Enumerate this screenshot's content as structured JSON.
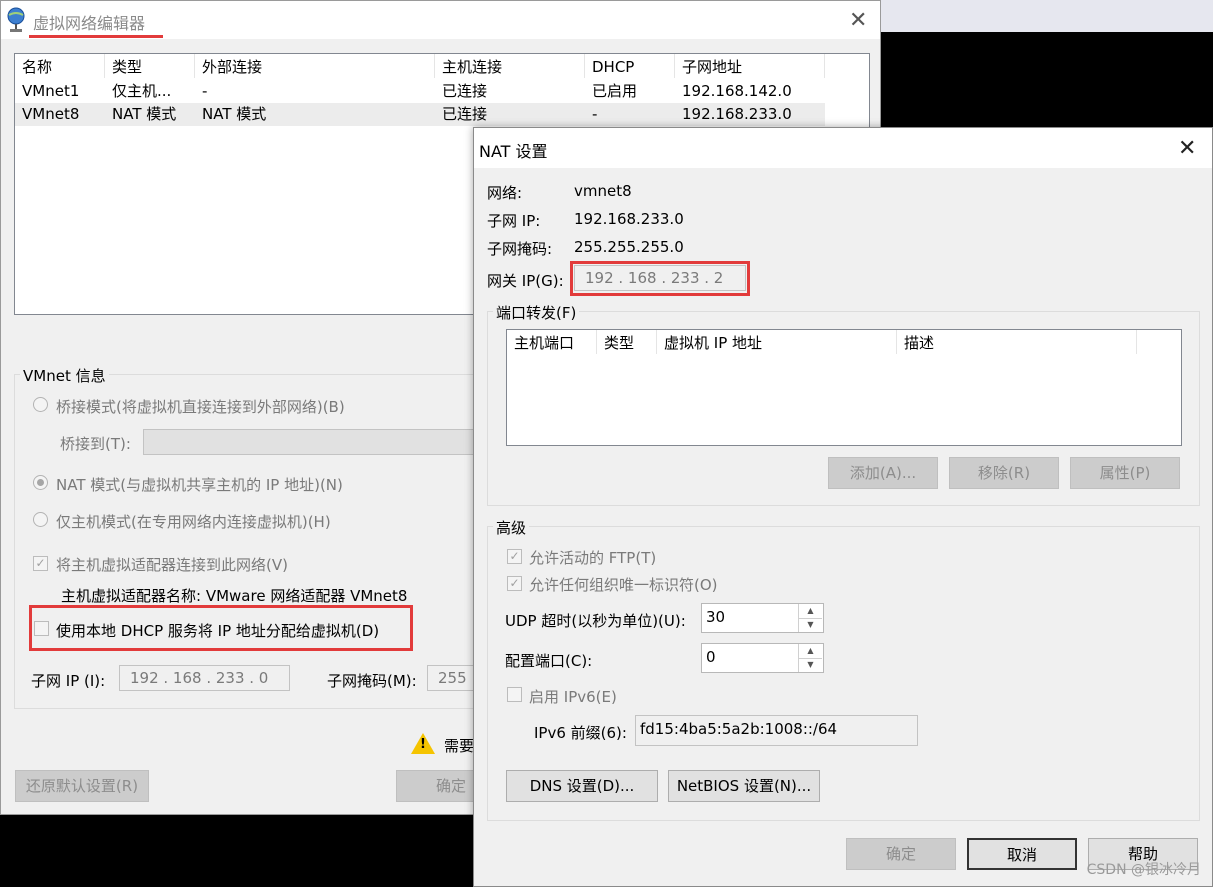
{
  "main_window": {
    "title": "虚拟网络编辑器",
    "close_glyph": "✕",
    "columns": [
      "名称",
      "类型",
      "外部连接",
      "主机连接",
      "DHCP",
      "子网地址"
    ],
    "rows": [
      [
        "VMnet1",
        "仅主机...",
        "-",
        "已连接",
        "已启用",
        "192.168.142.0"
      ],
      [
        "VMnet8",
        "NAT 模式",
        "NAT 模式",
        "已连接",
        "-",
        "192.168.233.0"
      ]
    ],
    "vmnet_info": {
      "title": "VMnet 信息",
      "bridged_label": "桥接模式(将虚拟机直接连接到外部网络)(B)",
      "bridge_to_label": "桥接到(T):",
      "nat_label": "NAT 模式(与虚拟机共享主机的 IP 地址)(N)",
      "hostonly_label": "仅主机模式(在专用网络内连接虚拟机)(H)",
      "connect_adapter_label": "将主机虚拟适配器连接到此网络(V)",
      "adapter_name_label": "主机虚拟适配器名称: VMware 网络适配器 VMnet8",
      "dhcp_label": "使用本地 DHCP 服务将 IP 地址分配给虚拟机(D)",
      "subnet_ip_label": "子网 IP (I):",
      "subnet_ip_value": "192 . 168 . 233 .  0",
      "subnet_mask_label": "子网掩码(M):",
      "subnet_mask_value": "255"
    },
    "warning_text": "需要",
    "restore_button": "还原默认设置(R)",
    "ok_button": "确定"
  },
  "nat_dialog": {
    "title": "NAT 设置",
    "close_glyph": "✕",
    "network_label": "网络:",
    "network_value": "vmnet8",
    "subnet_ip_label": "子网 IP:",
    "subnet_ip_value": "192.168.233.0",
    "subnet_mask_label": "子网掩码:",
    "subnet_mask_value": "255.255.255.0",
    "gateway_label": "网关 IP(G):",
    "gateway_value": "192 . 168 . 233 .  2",
    "port_forward": {
      "title": "端口转发(F)",
      "columns": [
        "主机端口",
        "类型",
        "虚拟机 IP 地址",
        "描述"
      ],
      "add_button": "添加(A)...",
      "remove_button": "移除(R)",
      "props_button": "属性(P)"
    },
    "advanced": {
      "title": "高级",
      "ftp_label": "允许活动的 FTP(T)",
      "oui_label": "允许任何组织唯一标识符(O)",
      "udp_label": "UDP 超时(以秒为单位)(U):",
      "udp_value": "30",
      "config_port_label": "配置端口(C):",
      "config_port_value": "0",
      "ipv6_label": "启用 IPv6(E)",
      "ipv6_prefix_label": "IPv6 前缀(6):",
      "ipv6_prefix_value": "fd15:4ba5:5a2b:1008::/64",
      "dns_button": "DNS 设置(D)...",
      "netbios_button": "NetBIOS 设置(N)..."
    },
    "ok_button": "确定",
    "cancel_button": "取消",
    "help_button": "帮助"
  },
  "watermark": "CSDN @银冰冷月",
  "colors": {
    "highlight_red": "#e23b3b"
  }
}
